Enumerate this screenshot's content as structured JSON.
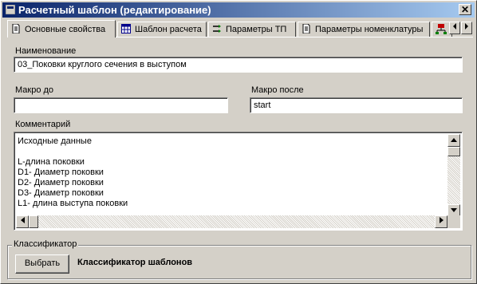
{
  "window": {
    "title": "Расчетный шаблон (редактирование)",
    "close_label": "✕"
  },
  "tabs": [
    {
      "label": "Основные свойства",
      "icon": "document-icon",
      "active": true
    },
    {
      "label": "Шаблон расчета",
      "icon": "grid-icon",
      "active": false
    },
    {
      "label": "Параметры ТП",
      "icon": "parameters-icon",
      "active": false
    },
    {
      "label": "Параметры номенклатуры",
      "icon": "document-list-icon",
      "active": false
    }
  ],
  "fields": {
    "name": {
      "label": "Наименование",
      "value": "03_Поковки круглого сечения в выступом"
    },
    "macro_before": {
      "label": "Макро до",
      "value": ""
    },
    "macro_after": {
      "label": "Макро после",
      "value": "start"
    },
    "comment": {
      "label": "Комментарий",
      "lines": [
        "Исходные данные",
        "",
        "L-длина поковки",
        "D1- Диаметр поковки",
        "D2- Диаметр поковки",
        "D3- Диаметр поковки",
        "L1- длина выступа поковки"
      ]
    }
  },
  "classifier": {
    "group_title": "Классификатор",
    "button_label": "Выбрать",
    "value": "Классификатор шаблонов"
  }
}
